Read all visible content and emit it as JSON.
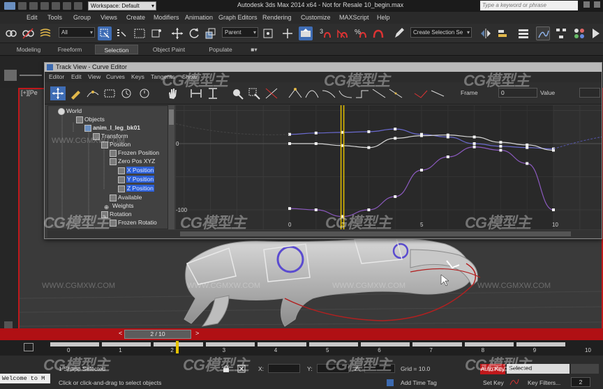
{
  "app": {
    "title": "Autodesk 3ds Max  2014 x64  - Not for Resale   10_begin.max",
    "workspace": "Workspace: Default",
    "search_placeholder": "Type a keyword or phrase"
  },
  "menu": [
    "Edit",
    "Tools",
    "Group",
    "Views",
    "Create",
    "Modifiers",
    "Animation",
    "Graph Editors",
    "Rendering",
    "Customize",
    "MAXScript",
    "Help"
  ],
  "toolbar": {
    "filter": "All",
    "coord": "Parent",
    "selection_set": "Create Selection Se",
    "snap_label": "3",
    "percent_snap": "%",
    "angle_snap": "n"
  },
  "ribbon_tabs": [
    "Modeling",
    "Freeform",
    "Selection",
    "Object Paint",
    "Populate"
  ],
  "ribbon_active": "Selection",
  "viewport": {
    "label": "[+][Pe"
  },
  "trackview": {
    "title": "Track View - Curve Editor",
    "menu": [
      "Editor",
      "Edit",
      "View",
      "Curves",
      "Keys",
      "Tangents",
      "Show"
    ],
    "frame_label": "Frame",
    "frame_value": "0",
    "value_label": "Value",
    "tree": [
      {
        "label": "World",
        "icon": "world-icon"
      },
      {
        "label": "Objects",
        "icon": "objects-icon"
      },
      {
        "label": "anim_l_leg_bk01",
        "icon": "object-icon"
      },
      {
        "label": "Transform",
        "icon": "transform-icon"
      },
      {
        "label": "Position",
        "icon": "position-icon"
      },
      {
        "label": "Frozen Position",
        "icon": "track-icon"
      },
      {
        "label": "Zero Pos XYZ",
        "icon": "track-icon"
      },
      {
        "label": "X Position",
        "icon": "track-icon"
      },
      {
        "label": "Y Position",
        "icon": "track-icon"
      },
      {
        "label": "Z Position",
        "icon": "track-icon"
      },
      {
        "label": "Available",
        "icon": "track-icon"
      },
      {
        "label": "Weights",
        "icon": "weights-icon"
      },
      {
        "label": "Rotation",
        "icon": "rotation-icon"
      },
      {
        "label": "Frozen Rotatio",
        "icon": "track-icon"
      }
    ],
    "graph": {
      "y_labels": [
        "0",
        "-100"
      ],
      "x_labels": [
        "0",
        "5",
        "10"
      ],
      "current_frame_label": "2"
    }
  },
  "timeline": {
    "slider": "2 / 10",
    "ticks": [
      "0",
      "1",
      "2",
      "3",
      "4",
      "5",
      "6",
      "7",
      "8",
      "9",
      "10"
    ],
    "prev": "<",
    "next": ">"
  },
  "status": {
    "welcome": "Welcome to M",
    "shapes_selected": "1 Shape Selected",
    "prompt": "Click or click-and-drag to select objects",
    "x_label": "X:",
    "y_label": "Y:",
    "z_label": "Z:",
    "grid": "Grid = 10.0",
    "add_time_tag": "Add Time Tag",
    "auto_key": "Auto Key",
    "set_key": "Set Key",
    "selected": "Selected",
    "key_filters": "Key Filters...",
    "frame": "2"
  },
  "watermark": {
    "brand": "CG模型主",
    "url": "WWW.CGMXW.COM"
  },
  "colors": {
    "accent_red": "#c0181b",
    "selection_blue": "#2c5fd6",
    "curve_blue": "#5a5ab8",
    "curve_purple": "#9b4fbf",
    "time_bar_yellow": "#e6c200"
  }
}
